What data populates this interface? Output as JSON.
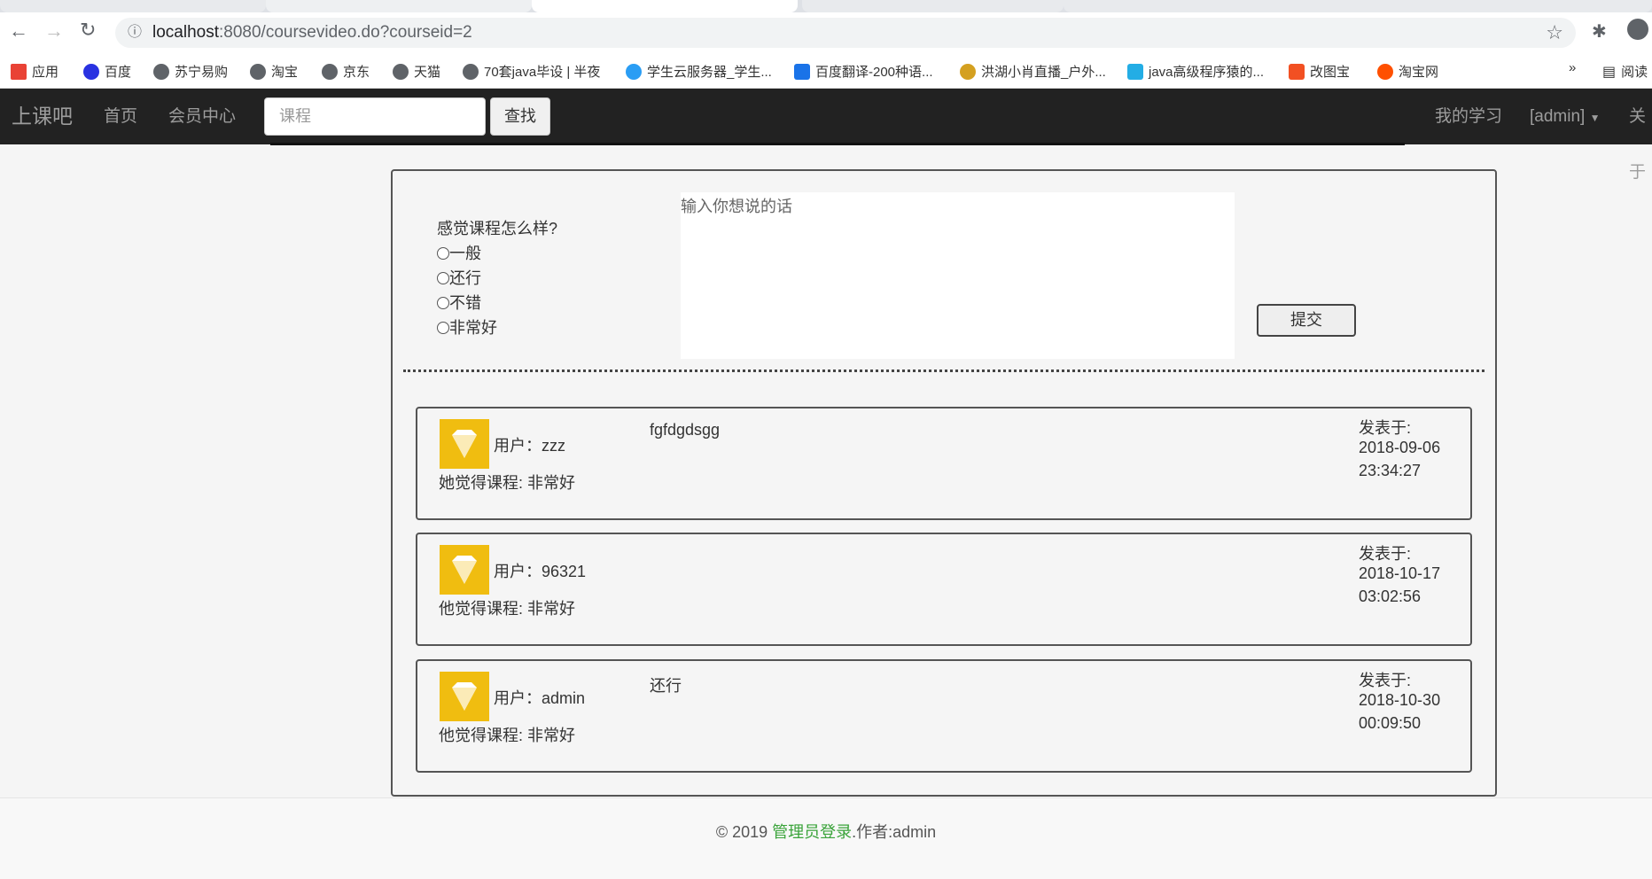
{
  "browser": {
    "url_host": "localhost",
    "url_rest": ":8080/coursevideo.do?courseid=2",
    "bookmarks": [
      "应用",
      "百度",
      "苏宁易购",
      "淘宝",
      "京东",
      "天猫",
      "70套java毕设 | 半夜",
      "学生云服务器_学生...",
      "百度翻译-200种语...",
      "洪湖小肖直播_户外...",
      "java高级程序猿的...",
      "改图宝",
      "淘宝网"
    ],
    "bookmarks_more": "»",
    "reading_list": "阅读"
  },
  "navbar": {
    "brand": "上课吧",
    "home": "首页",
    "member": "会员中心",
    "search_placeholder": "课程",
    "search_button": "查找",
    "my_study": "我的学习",
    "user": "[admin]",
    "about": "关于"
  },
  "feedback": {
    "question": "感觉课程怎么样?",
    "options": [
      "一般",
      "还行",
      "不错",
      "非常好"
    ],
    "textarea_placeholder": "输入你想说的话",
    "submit": "提交"
  },
  "comments": [
    {
      "user": "用户：zzz",
      "content": "fgfdgdsgg",
      "rating": "她觉得课程: 非常好",
      "posted_label": "发表于:",
      "date": "2018-09-06",
      "time": "23:34:27"
    },
    {
      "user": "用户：96321",
      "content": "",
      "rating": "他觉得课程: 非常好",
      "posted_label": "发表于:",
      "date": "2018-10-17",
      "time": "03:02:56"
    },
    {
      "user": "用户：admin",
      "content": "还行",
      "rating": "他觉得课程: 非常好",
      "posted_label": "发表于:",
      "date": "2018-10-30",
      "time": "00:09:50"
    }
  ],
  "footer": {
    "copyright": "© 2019 ",
    "admin_link": "管理员登录",
    "author": ".作者:admin"
  },
  "colors": {
    "navbar": "#222222",
    "avatar": "#f0bd10",
    "link": "#3aa33a"
  }
}
